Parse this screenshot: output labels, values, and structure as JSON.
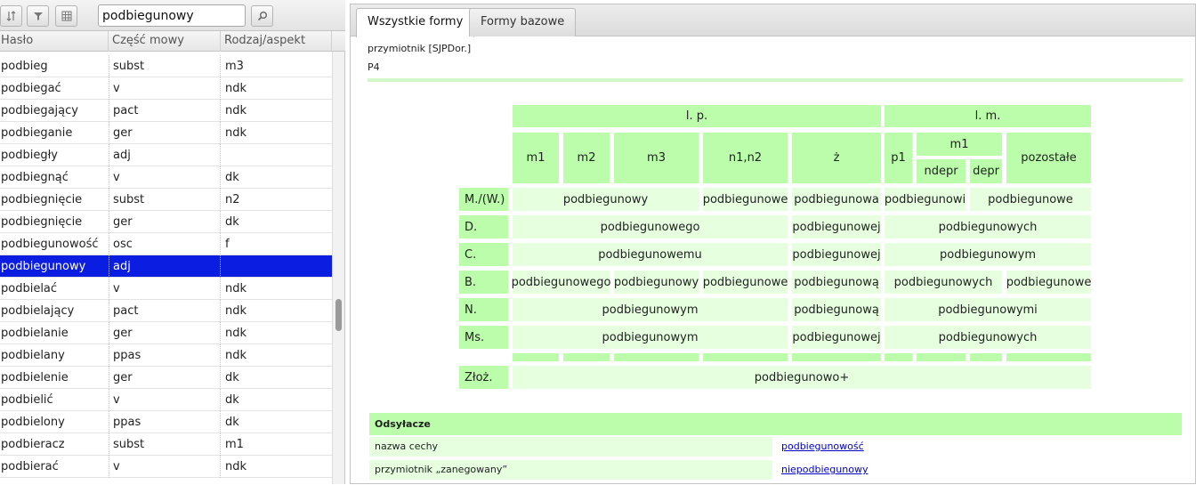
{
  "left": {
    "toolbar": {
      "sort_icon": "sort-icon",
      "filter_icon": "filter-icon",
      "grid_icon": "grid-icon",
      "search_value": "podbiegunowy",
      "search_icon": "search-icon"
    },
    "columns": [
      "Hasło",
      "Część mowy",
      "Rodzaj/aspekt"
    ],
    "rows": [
      {
        "haslo": "podbieg",
        "pos": "subst",
        "rodzaj": "m3"
      },
      {
        "haslo": "podbiegać",
        "pos": "v",
        "rodzaj": "ndk"
      },
      {
        "haslo": "podbiegający",
        "pos": "pact",
        "rodzaj": "ndk"
      },
      {
        "haslo": "podbieganie",
        "pos": "ger",
        "rodzaj": "ndk"
      },
      {
        "haslo": "podbiegły",
        "pos": "adj",
        "rodzaj": ""
      },
      {
        "haslo": "podbiegnąć",
        "pos": "v",
        "rodzaj": "dk"
      },
      {
        "haslo": "podbiegnięcie",
        "pos": "subst",
        "rodzaj": "n2"
      },
      {
        "haslo": "podbiegnięcie",
        "pos": "ger",
        "rodzaj": "dk"
      },
      {
        "haslo": "podbiegunowość",
        "pos": "osc",
        "rodzaj": "f"
      },
      {
        "haslo": "podbiegunowy",
        "pos": "adj",
        "rodzaj": "",
        "selected": true
      },
      {
        "haslo": "podbielać",
        "pos": "v",
        "rodzaj": "ndk"
      },
      {
        "haslo": "podbielający",
        "pos": "pact",
        "rodzaj": "ndk"
      },
      {
        "haslo": "podbielanie",
        "pos": "ger",
        "rodzaj": "ndk"
      },
      {
        "haslo": "podbielany",
        "pos": "ppas",
        "rodzaj": "ndk"
      },
      {
        "haslo": "podbielenie",
        "pos": "ger",
        "rodzaj": "dk"
      },
      {
        "haslo": "podbielić",
        "pos": "v",
        "rodzaj": "dk"
      },
      {
        "haslo": "podbielony",
        "pos": "ppas",
        "rodzaj": "dk"
      },
      {
        "haslo": "podbieracz",
        "pos": "subst",
        "rodzaj": "m1"
      },
      {
        "haslo": "podbierać",
        "pos": "v",
        "rodzaj": "ndk"
      }
    ]
  },
  "right": {
    "tabs": [
      {
        "label": "Wszystkie formy",
        "active": true
      },
      {
        "label": "Formy bazowe",
        "active": false
      }
    ],
    "info_line1": "przymiotnik [SJPDor.]",
    "info_line2": "P4",
    "table": {
      "lp": "l. p.",
      "lm": "l. m.",
      "m1": "m1",
      "m2": "m2",
      "m3": "m3",
      "n1n2": "n1,n2",
      "z": "ż",
      "p1": "p1",
      "m1_lm": "m1",
      "ndepr": "ndepr",
      "depr": "depr",
      "pozostale": "pozostałe",
      "labels": {
        "mw": "M./(W.)",
        "d": "D.",
        "c": "C.",
        "b": "B.",
        "n": "N.",
        "ms": "Ms.",
        "zloz": "Złoż."
      },
      "forms": {
        "mw_m": "podbiegunowy",
        "mw_n": "podbiegunowe",
        "mw_z": "podbiegunowa",
        "mw_p1": "podbiegunowi",
        "mw_rest": "podbiegunowe",
        "d_m": "podbiegunowego",
        "d_z": "podbiegunowej",
        "d_pl": "podbiegunowych",
        "c_m": "podbiegunowemu",
        "c_z": "podbiegunowej",
        "c_pl": "podbiegunowym",
        "b_m1": "podbiegunowego",
        "b_m3": "podbiegunowy",
        "b_n": "podbiegunowe",
        "b_z": "podbiegunową",
        "b_m1pl": "podbiegunowych",
        "b_rest": "podbiegunowe",
        "n_m": "podbiegunowym",
        "n_z": "podbiegunową",
        "n_pl": "podbiegunowymi",
        "ms_m": "podbiegunowym",
        "ms_z": "podbiegunowej",
        "ms_pl": "podbiegunowych",
        "zloz": "podbiegunowo+"
      }
    },
    "refs": {
      "title": "Odsyłacze",
      "items": [
        {
          "label": "nazwa cechy",
          "link": "podbiegunowość"
        },
        {
          "label": "przymiotnik „zanegowany”",
          "link": "niepodbiegunowy"
        }
      ]
    }
  }
}
